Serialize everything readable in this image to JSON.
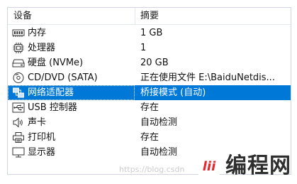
{
  "columns": {
    "device": "设备",
    "summary": "摘要"
  },
  "rows": [
    {
      "name": "内存",
      "summary": "1 GB",
      "icon": "memory-icon"
    },
    {
      "name": "处理器",
      "summary": "1",
      "icon": "processor-icon"
    },
    {
      "name": "硬盘 (NVMe)",
      "summary": "20 GB",
      "icon": "hard-disk-icon"
    },
    {
      "name": "CD/DVD (SATA)",
      "summary": "正在使用文件 E:\\BaiduNetdis...",
      "icon": "cd-dvd-icon"
    },
    {
      "name": "网络适配器",
      "summary": "桥接模式 (自动)",
      "icon": "network-adapter-icon",
      "selected": true
    },
    {
      "name": "USB 控制器",
      "summary": "存在",
      "icon": "usb-icon"
    },
    {
      "name": "声卡",
      "summary": "自动检测",
      "icon": "sound-card-icon"
    },
    {
      "name": "打印机",
      "summary": "存在",
      "icon": "printer-icon"
    },
    {
      "name": "显示器",
      "summary": "自动检测",
      "icon": "display-icon"
    }
  ],
  "watermark": {
    "text": "https://blog.csdn",
    "logo_text": "编程网",
    "logo_badge_text": "lii"
  },
  "colors": {
    "selection": "#0078d7",
    "logo_accent": "#e8262d"
  }
}
